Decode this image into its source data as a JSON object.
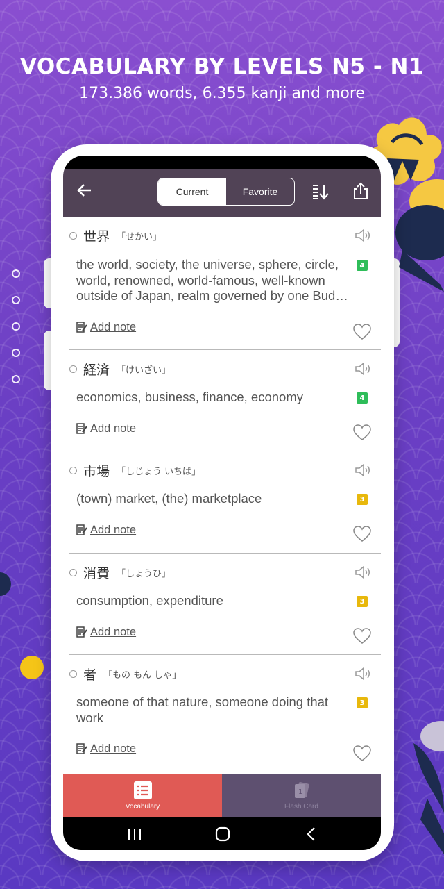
{
  "promo": {
    "headline": "VOCABULARY BY LEVELS N5 - N1",
    "subline": "173.386 words, 6.355 kanji and more"
  },
  "colors": {
    "appbar": "#514356",
    "tab_active": "#e05a55",
    "tab_inactive": "#5e5070",
    "level_4": "#2ebd59",
    "level_3": "#e8b80c"
  },
  "appbar": {
    "back_icon": "back-arrow-icon",
    "segment": {
      "current": "Current",
      "favorite": "Favorite",
      "selected": "Current"
    },
    "sort_icon": "sort-icon",
    "share_icon": "share-icon"
  },
  "words": [
    {
      "kanji": "世界",
      "kana": "「せかい」",
      "meaning": "the world, society, the universe, sphere, circle, world, renowned, world-famous, well-known outside of Japan, realm governed by one Bud…",
      "level": "4",
      "note": "Add note"
    },
    {
      "kanji": "経済",
      "kana": "「けいざい」",
      "meaning": "economics, business, finance, economy",
      "level": "4",
      "note": "Add note"
    },
    {
      "kanji": "市場",
      "kana": "「しじょう いちば」",
      "meaning": "(town) market, (the) marketplace",
      "level": "3",
      "note": "Add note"
    },
    {
      "kanji": "消費",
      "kana": "「しょうひ」",
      "meaning": "consumption, expenditure",
      "level": "3",
      "note": "Add note"
    },
    {
      "kanji": "者",
      "kana": "「もの もん しゃ」",
      "meaning": "someone of that nature, someone doing that work",
      "level": "3",
      "note": "Add note"
    }
  ],
  "tabs": [
    {
      "label": "Vocabulary",
      "icon": "list-icon",
      "active": true
    },
    {
      "label": "Flash Card",
      "icon": "flash-card-icon",
      "active": false
    }
  ]
}
